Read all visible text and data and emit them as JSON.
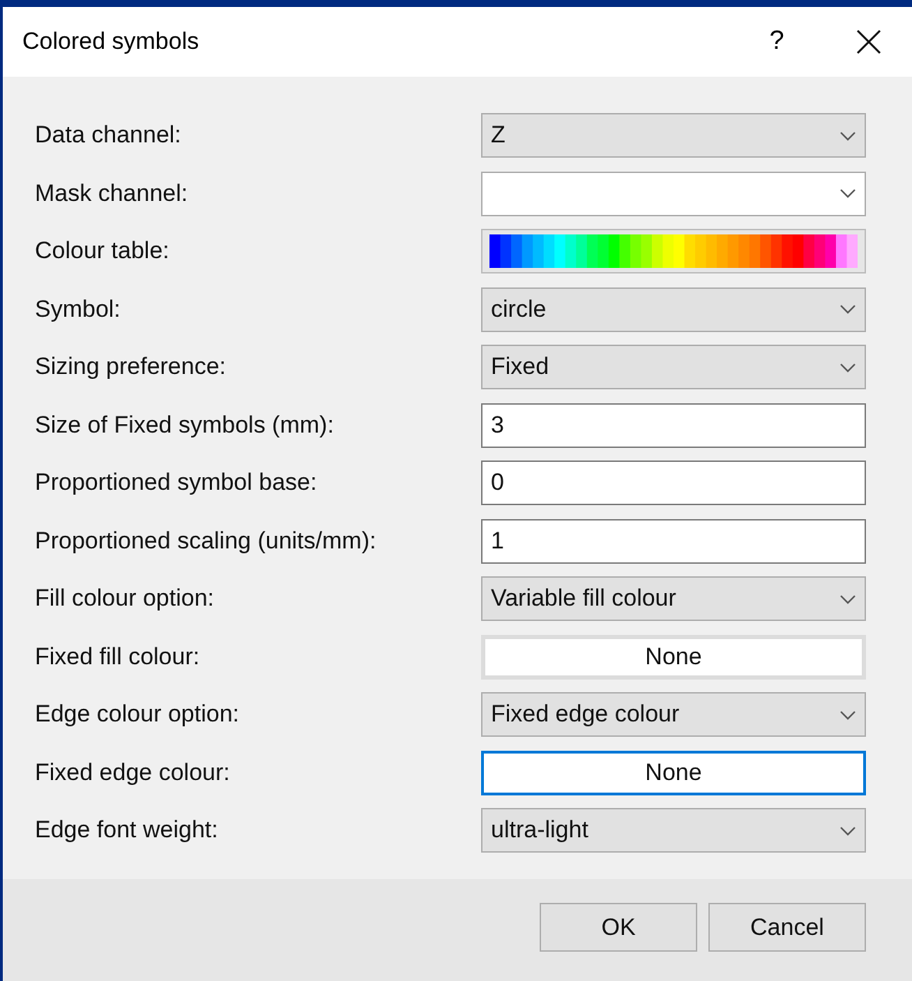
{
  "window": {
    "title": "Colored symbols",
    "help": "?"
  },
  "fields": [
    {
      "label": "Data channel:",
      "kind": "combo",
      "value": "Z"
    },
    {
      "label": "Mask channel:",
      "kind": "combo_white"
    },
    {
      "label": "Colour table:",
      "kind": "colortable"
    },
    {
      "label": "Symbol:",
      "kind": "combo",
      "value": "circle"
    },
    {
      "label": "Sizing preference:",
      "kind": "combo",
      "value": "Fixed"
    },
    {
      "label": "Size of Fixed symbols (mm):",
      "kind": "text",
      "value": "3"
    },
    {
      "label": "Proportioned symbol base:",
      "kind": "text",
      "value": "0"
    },
    {
      "label": "Proportioned scaling (units/mm):",
      "kind": "text",
      "value": "1"
    },
    {
      "label": "Fill colour option:",
      "kind": "combo",
      "value": "Variable fill colour"
    },
    {
      "label": "Fixed fill colour:",
      "kind": "colorbutton",
      "value": "None",
      "focused": false
    },
    {
      "label": "Edge colour option:",
      "kind": "combo",
      "value": "Fixed edge colour"
    },
    {
      "label": "Fixed edge colour:",
      "kind": "colorbutton",
      "value": "None",
      "focused": true
    },
    {
      "label": "Edge font weight:",
      "kind": "combo",
      "value": "ultra-light"
    }
  ],
  "buttons": [
    "OK",
    "Cancel"
  ]
}
